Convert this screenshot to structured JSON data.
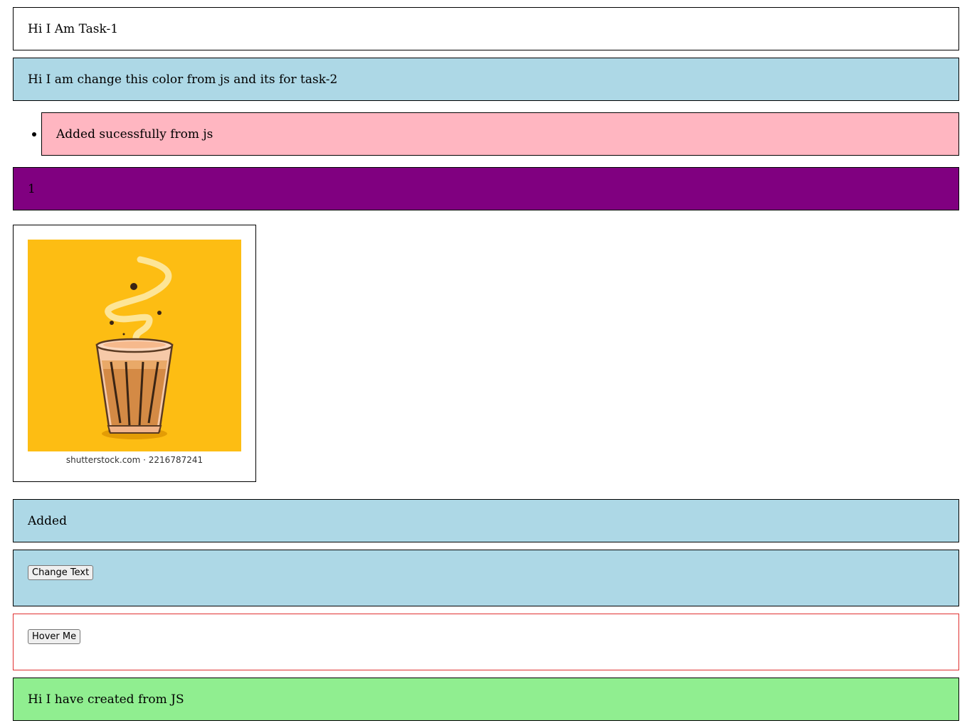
{
  "task1": {
    "text": "Hi I Am Task-1"
  },
  "task2": {
    "text": "Hi I am change this color from js and its for task-2",
    "background": "#add8e6"
  },
  "list": {
    "items": [
      {
        "label": "Added sucessfully from js"
      }
    ],
    "item_background": "#ffb6c1"
  },
  "counter": {
    "value": "1",
    "background": "#800080"
  },
  "image": {
    "icon": "chai-glass-icon",
    "caption": "shutterstock.com · 2216787241",
    "background": "#fdbd13"
  },
  "added": {
    "text": "Added",
    "background": "#add8e6"
  },
  "change_text": {
    "button_label": "Change Text",
    "background": "#add8e6"
  },
  "hover": {
    "button_label": "Hover Me",
    "border_color": "#e03030"
  },
  "created": {
    "text": "Hi I have created from JS",
    "background": "#90ee90"
  }
}
